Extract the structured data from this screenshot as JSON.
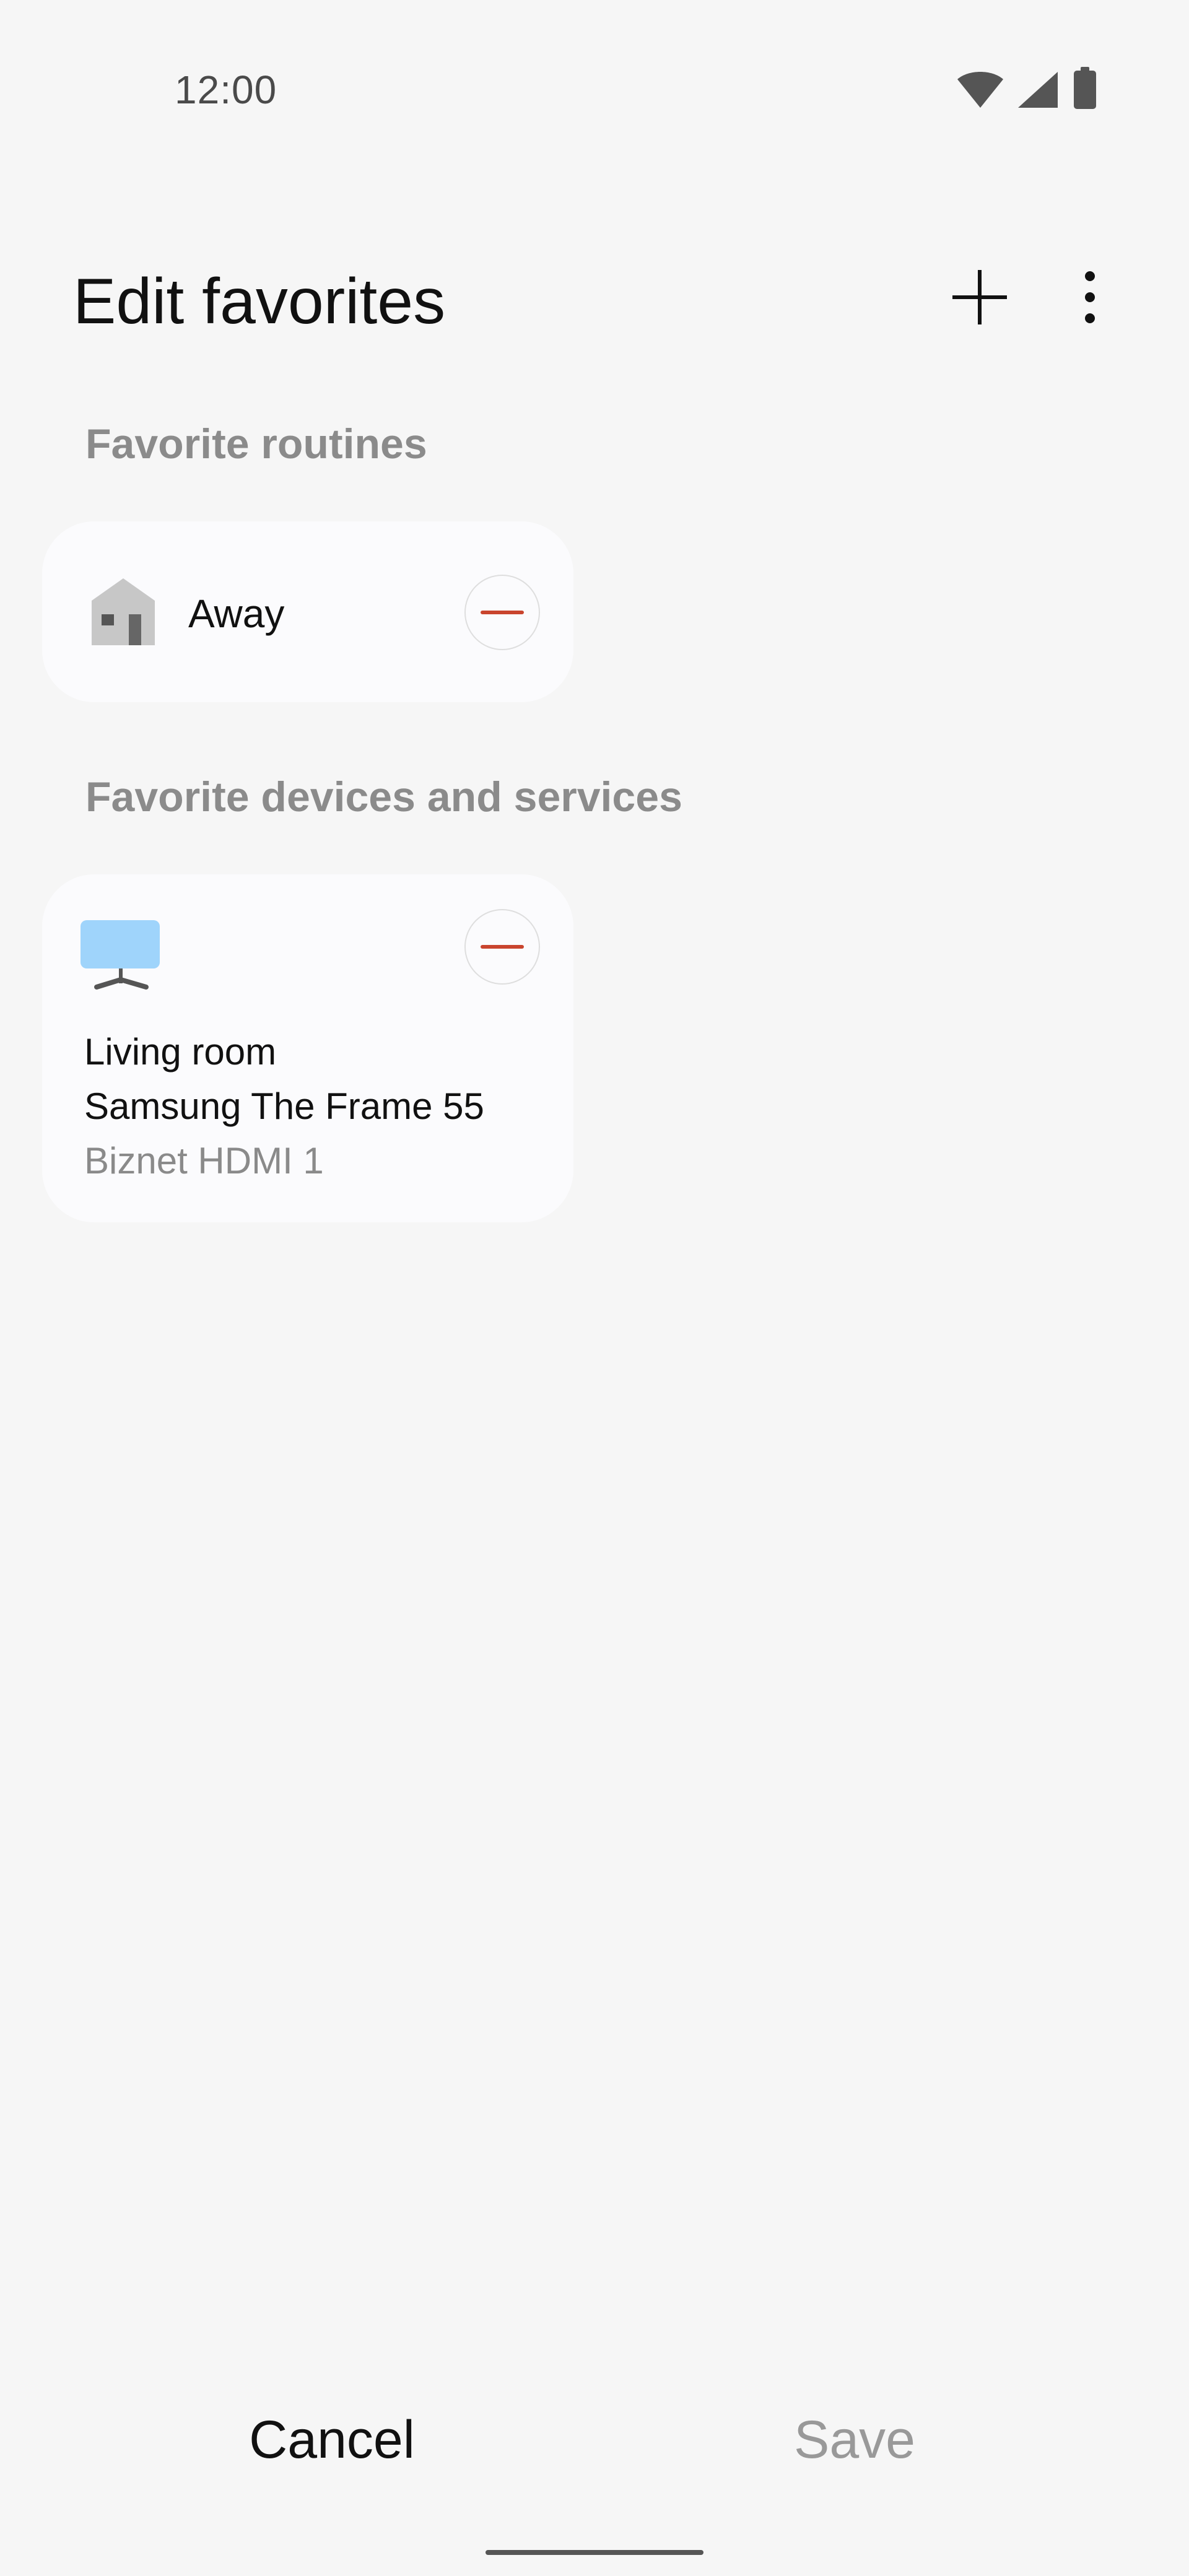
{
  "status_bar": {
    "time": "12:00",
    "icons": [
      "wifi-icon",
      "signal-icon",
      "battery-icon"
    ]
  },
  "header": {
    "title": "Edit favorites",
    "actions": [
      "plus-icon",
      "more-vert-icon"
    ]
  },
  "sections": {
    "routines": {
      "heading": "Favorite routines",
      "items": [
        {
          "label": "Away",
          "icon": "house-icon"
        }
      ]
    },
    "devices": {
      "heading": "Favorite devices and services",
      "items": [
        {
          "room": "Living room",
          "name": "Samsung The Frame 55",
          "source": "Biznet HDMI 1",
          "icon": "tv-icon"
        }
      ]
    }
  },
  "bottom_actions": {
    "cancel_label": "Cancel",
    "save_label": "Save"
  },
  "colors": {
    "background": "#f6f6f6",
    "card": "#fbfbfd",
    "remove_accent": "#c9452e",
    "tv_screen": "#9fd4fb",
    "disabled_text": "#999999"
  }
}
